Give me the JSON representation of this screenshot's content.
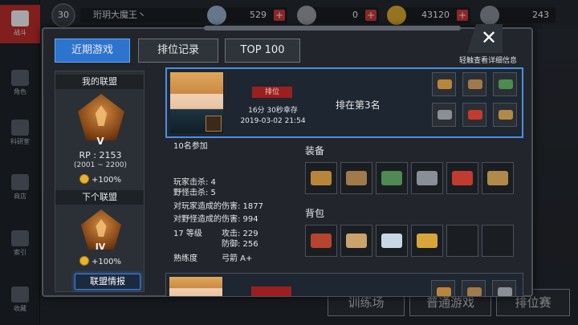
{
  "topbar": {
    "level": "30",
    "player_name": "珩玥大魔王丶",
    "resources": [
      {
        "name": "crystal",
        "value": "529",
        "color": "#9db7d6"
      },
      {
        "name": "chip",
        "value": "0",
        "color": "#a0a4aa"
      },
      {
        "name": "gold",
        "value": "43120",
        "color": "#e3b22f"
      },
      {
        "name": "bp",
        "value": "243",
        "color": "#8f969f"
      }
    ],
    "plus": "+"
  },
  "leftnav": {
    "items": [
      {
        "label": "战斗",
        "icon": "battle-icon"
      },
      {
        "label": "角色",
        "icon": "character-icon"
      },
      {
        "label": "科研室",
        "icon": "lab-icon"
      },
      {
        "label": "商店",
        "icon": "shop-icon"
      },
      {
        "label": "索引",
        "icon": "index-icon"
      },
      {
        "label": "收藏",
        "icon": "collection-icon"
      }
    ]
  },
  "background_buttons": [
    "训练场",
    "普通游戏",
    "排位赛"
  ],
  "modal": {
    "tabs": [
      "近期游戏",
      "排位记录",
      "TOP 100"
    ],
    "close": "✕",
    "hint": "轻触查看详细信息",
    "alliance": {
      "title": "我的联盟",
      "rank": "V",
      "rp": "RP : 2153",
      "range": "(2001 ~ 2200)",
      "bonus": "+100%",
      "next_title": "下个联盟",
      "next_rank": "IV",
      "next_bonus": "+100%",
      "info_button": "联盟情报"
    },
    "match": {
      "mode": "排位",
      "survive": "16分 30秒幸存",
      "date": "2019-03-02 21:54",
      "rank_text": "排在第3名",
      "participants": "10名参加",
      "player_kills": "玩家击杀: 4",
      "monster_kills": "野怪击杀: 5",
      "player_damage": "对玩家造成的伤害: 1877",
      "monster_damage": "对野怪造成的伤害: 994",
      "level": "17 等级",
      "attack": "攻击: 229",
      "defense": "防御: 256",
      "proficiency_label": "熟练度",
      "proficiency_value": "弓箭 A+",
      "equipment_title": "装备",
      "backpack_title": "背包",
      "equipment": [
        {
          "icon": "crossbow-icon",
          "color": "#b8863a"
        },
        {
          "icon": "boots-icon",
          "color": "#a07a4a"
        },
        {
          "icon": "laptop-icon",
          "color": "#4f8a52"
        },
        {
          "icon": "knife-icon",
          "color": "#8a8f97"
        },
        {
          "icon": "red-gloves-icon",
          "color": "#c23b2f"
        },
        {
          "icon": "box-icon",
          "color": "#b08a4a"
        }
      ],
      "backpack": [
        {
          "icon": "meat-icon",
          "color": "#b8432e"
        },
        {
          "icon": "fish-icon",
          "color": "#c9a36a"
        },
        {
          "icon": "water-icon",
          "color": "#c8d7e6"
        },
        {
          "icon": "bowl-icon",
          "color": "#d7a53a"
        }
      ]
    }
  }
}
